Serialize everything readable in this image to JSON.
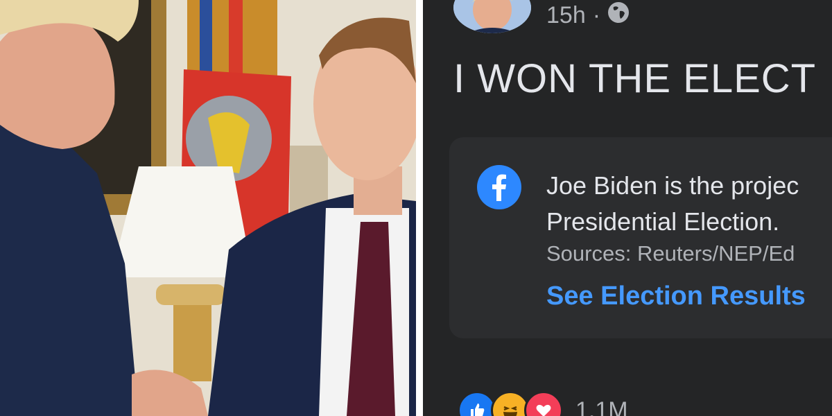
{
  "left_panel": {
    "image_description_name": "photo"
  },
  "post": {
    "time": "15h",
    "separator": "·",
    "audience_icon": "globe-icon",
    "text": "I WON THE ELECT"
  },
  "election_card": {
    "icon": "facebook-logo-icon",
    "line1": "Joe Biden is the projec",
    "line2": "Presidential Election.",
    "sources": "Sources: Reuters/NEP/Ed",
    "link": "See Election Results"
  },
  "reactions": {
    "icons": [
      "like-icon",
      "haha-icon",
      "love-icon"
    ],
    "count": "1.1M"
  },
  "colors": {
    "background": "#242526",
    "card": "#2c2d2f",
    "link": "#4599ff",
    "facebook_blue": "#2d88ff",
    "secondary_text": "#b0b3b8"
  }
}
